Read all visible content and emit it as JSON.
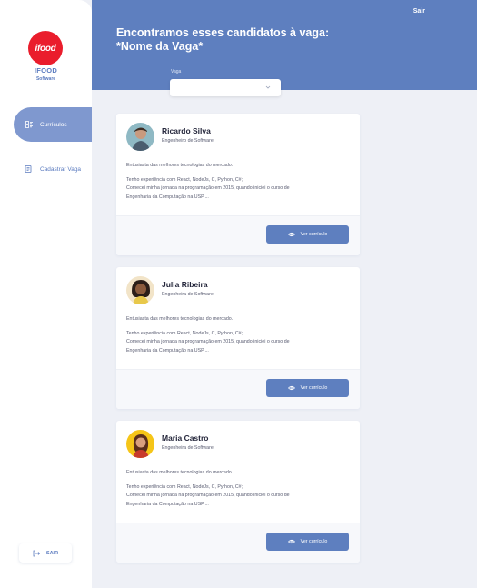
{
  "sidebar": {
    "logo_text": "ifood",
    "brand": "IFOOD",
    "brand_sub": "Software",
    "nav": [
      {
        "label": "Currículos",
        "icon": "list-icon",
        "active": true
      },
      {
        "label": "Cadastrar Vaga",
        "icon": "document-icon",
        "active": false
      }
    ],
    "logout_label": "SAIR",
    "logout_icon": "logout-icon"
  },
  "header": {
    "title_line1": "Encontramos esses candidatos à vaga:",
    "title_line2": "*Nome da Vaga*",
    "sair": "Sair",
    "vaga_label": "Vaga",
    "vaga_value": ""
  },
  "candidates": [
    {
      "name": "Ricardo Silva",
      "role": "Engenheiro de Software",
      "line1": "Entusiasta das melhores tecnologias do mercado.",
      "line2": "Tenho experiência com React, NodeJs, C, Python, C#;",
      "line3": "Comecei minha jornada na programação em 2015, quando iniciei o curso de",
      "line4": "Engenharia da Computação na USP....",
      "button": "Ver currículo"
    },
    {
      "name": "Julia Ribeira",
      "role": "Engenheira de Software",
      "line1": "Entusiasta das melhores tecnologias do mercado.",
      "line2": "Tenho experiência com React, NodeJs, C, Python, C#;",
      "line3": "Comecei minha jornada na programação em 2015, quando iniciei o curso de",
      "line4": "Engenharia da Computação na USP....",
      "button": "Ver currículo"
    },
    {
      "name": "Maria Castro",
      "role": "Engenheira de Software",
      "line1": "Entusiasta das melhores tecnologias do mercado.",
      "line2": "Tenho experiência com React, NodeJs, C, Python, C#;",
      "line3": "Comecei minha jornada na programação em 2015, quando iniciei o curso de",
      "line4": "Engenharia da Computação na USP....",
      "button": "Ver currículo"
    }
  ],
  "colors": {
    "primary": "#5e7fbf",
    "active_nav": "#7f98cf",
    "brand_red": "#ea1d2c",
    "background": "#eef0f6"
  }
}
